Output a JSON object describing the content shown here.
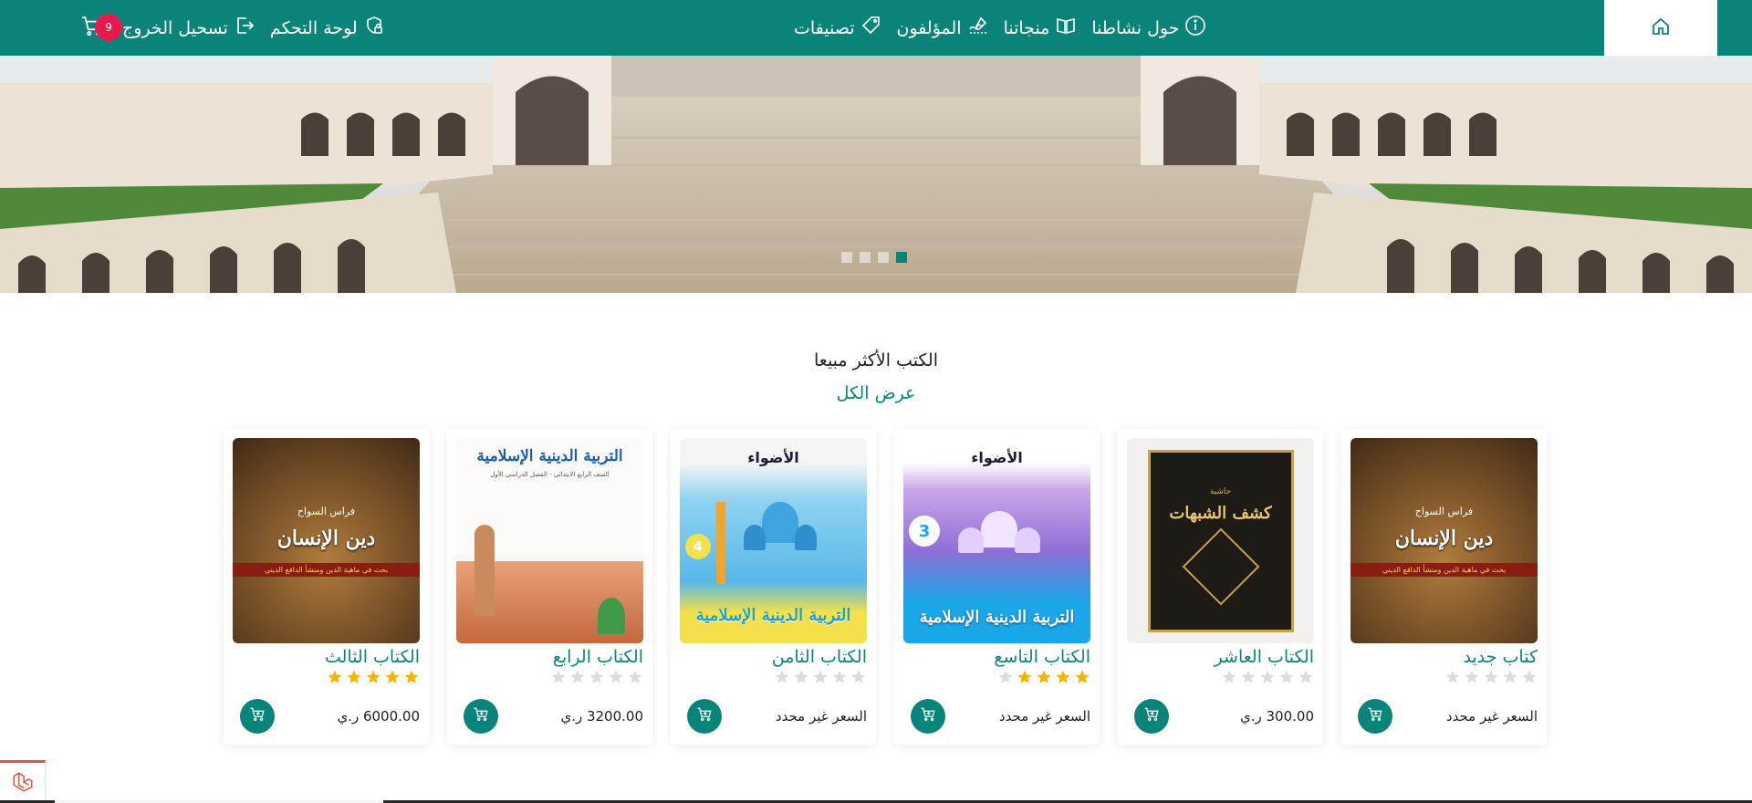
{
  "nav": {
    "home_icon": "home-icon",
    "items": [
      {
        "label": "حول نشاطنا",
        "icon": "info-icon"
      },
      {
        "label": "منجاتنا",
        "icon": "book-open-icon"
      },
      {
        "label": "المؤلفون",
        "icon": "pen-signature-icon"
      },
      {
        "label": "تصنيفات",
        "icon": "tag-icon"
      }
    ],
    "dashboard_label": "لوحة التحكم",
    "logout_label": "تسحيل الخروج",
    "cart_count": "9",
    "accent": "#0a8478",
    "badge_color": "#e8194f"
  },
  "hero": {
    "slides": 4,
    "active_slide": 4
  },
  "section": {
    "title": "الكتب الأكثر مبيعا",
    "view_all": "عرض الكل"
  },
  "books": [
    {
      "title": "كتاب جديد",
      "rating": 0,
      "price": "السعر غير محدد",
      "cover_title": "دين الإنسان",
      "cover_author": "فراس السواح",
      "cover_sub": "بحث في ماهية الدين ومنشأ الدافع الديني"
    },
    {
      "title": "الكتاب العاشر",
      "rating": 0,
      "price": "300.00 ر.ي",
      "cover_title": "كشف الشبهات",
      "cover_author": "حاشية",
      "cover_sub": ""
    },
    {
      "title": "الكتاب التاسع",
      "rating": 4,
      "price": "السعر غير محدد",
      "cover_title": "التربية الدينية الإسلامية",
      "cover_author": "الأضواء",
      "cover_sub": "3"
    },
    {
      "title": "الكتاب الثامن",
      "rating": 0,
      "price": "السعر غير محدد",
      "cover_title": "التربية الدينية الإسلامية",
      "cover_author": "الأضواء",
      "cover_sub": "4"
    },
    {
      "title": "الكتاب الرابع",
      "rating": 0,
      "price": "3200.00 ر.ي",
      "cover_title": "التربية الدينية الإسلامية",
      "cover_author": "",
      "cover_sub": "الصف الرابع الابتدائي - الفصل الدراسي الأول"
    },
    {
      "title": "الكتاب الثالث",
      "rating": 5,
      "price": "6000.00 ر.ي",
      "cover_title": "دين الإنسان",
      "cover_author": "فراس السواح",
      "cover_sub": "بحث في ماهية الدين ومنشأ الدافع الديني"
    }
  ]
}
